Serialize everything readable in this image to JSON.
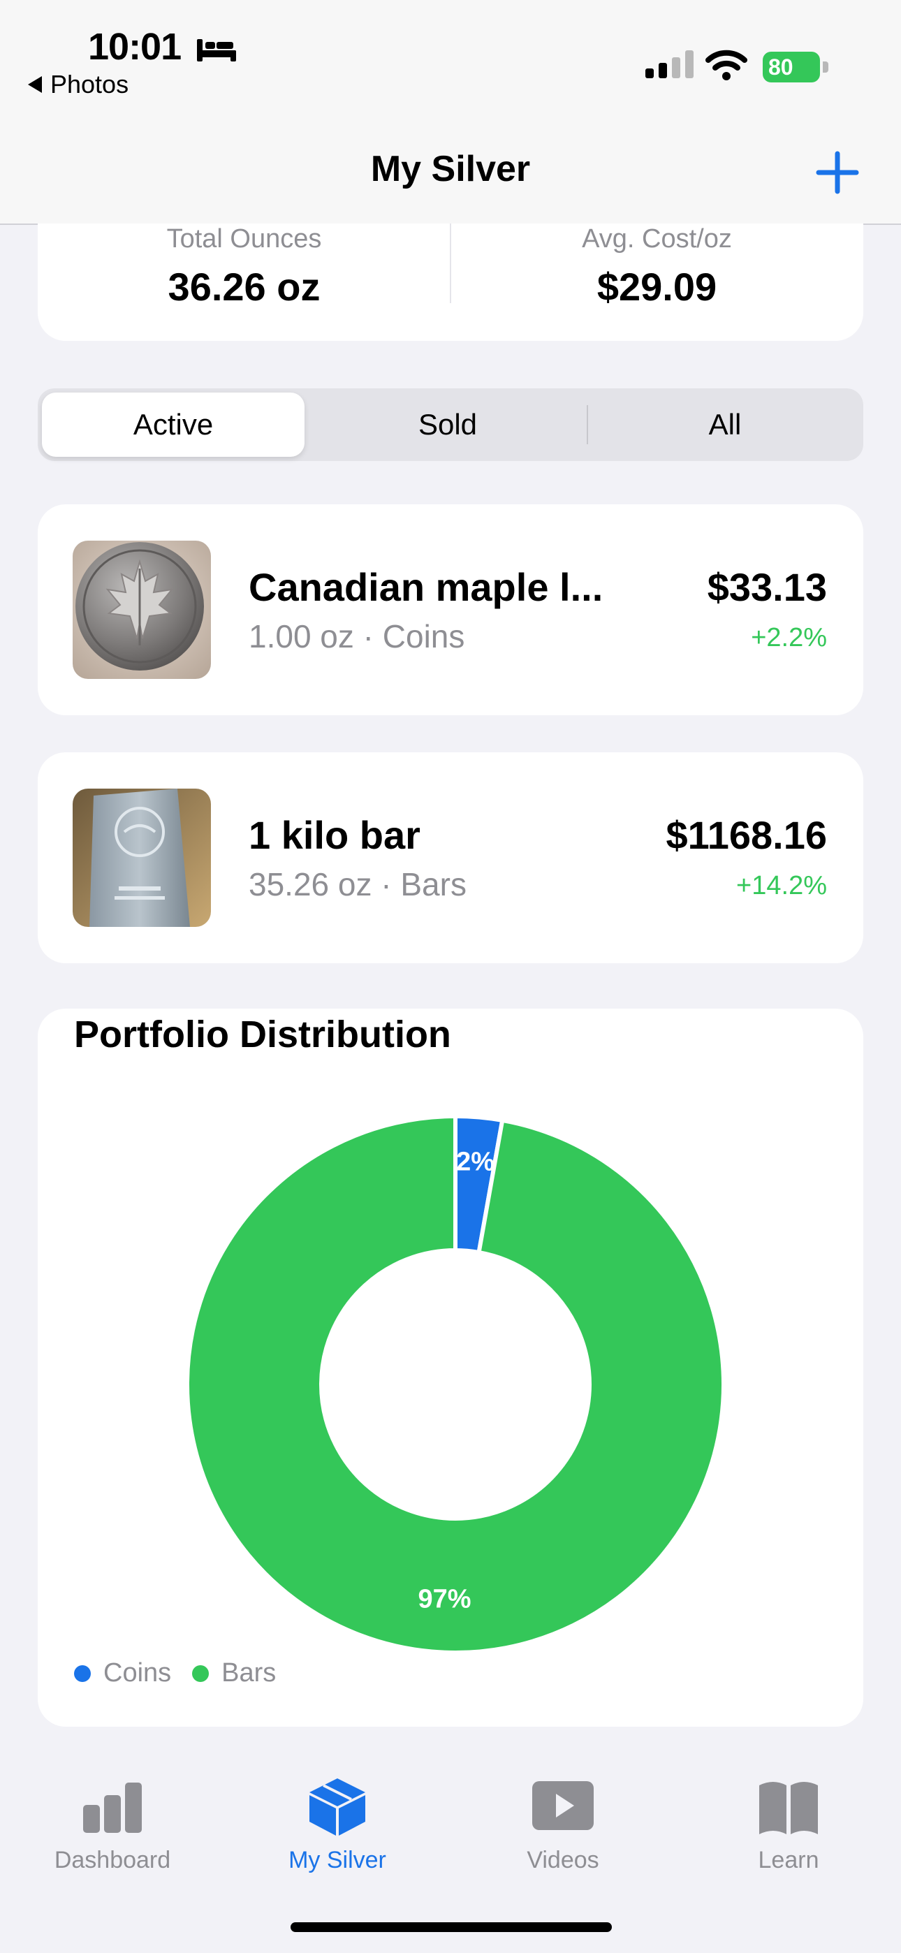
{
  "status_bar": {
    "time": "10:01",
    "back_label": "Photos",
    "battery": "80"
  },
  "nav": {
    "title": "My Silver",
    "add_icon": "plus-icon"
  },
  "summary": {
    "total_ounces_label": "Total Ounces",
    "total_ounces_value": "36.26 oz",
    "avg_cost_label": "Avg. Cost/oz",
    "avg_cost_value": "$29.09"
  },
  "filter": {
    "segments": [
      "Active",
      "Sold",
      "All"
    ],
    "selected": "Active"
  },
  "holdings": [
    {
      "name": "Canadian maple l...",
      "detail": "1.00 oz · Coins",
      "price": "$33.13",
      "change": "+2.2%"
    },
    {
      "name": "1 kilo bar",
      "detail": "35.26 oz · Bars",
      "price": "$1168.16",
      "change": "+14.2%"
    }
  ],
  "chart_data": {
    "type": "pie",
    "title": "Portfolio Distribution",
    "categories": [
      "Coins",
      "Bars"
    ],
    "values": [
      2.8,
      97.2
    ],
    "slice_labels": [
      "2%",
      "97%"
    ],
    "colors": [
      "#1a73e8",
      "#34c759"
    ],
    "legend_position": "bottom-left"
  },
  "tabs": [
    {
      "label": "Dashboard",
      "icon": "chart-bar-icon"
    },
    {
      "label": "My Silver",
      "icon": "cube-icon"
    },
    {
      "label": "Videos",
      "icon": "play-icon"
    },
    {
      "label": "Learn",
      "icon": "book-icon"
    }
  ],
  "active_tab": "My Silver",
  "colors": {
    "accent": "#1a73e8",
    "positive": "#34c759",
    "secondary_text": "#8e8e93"
  }
}
